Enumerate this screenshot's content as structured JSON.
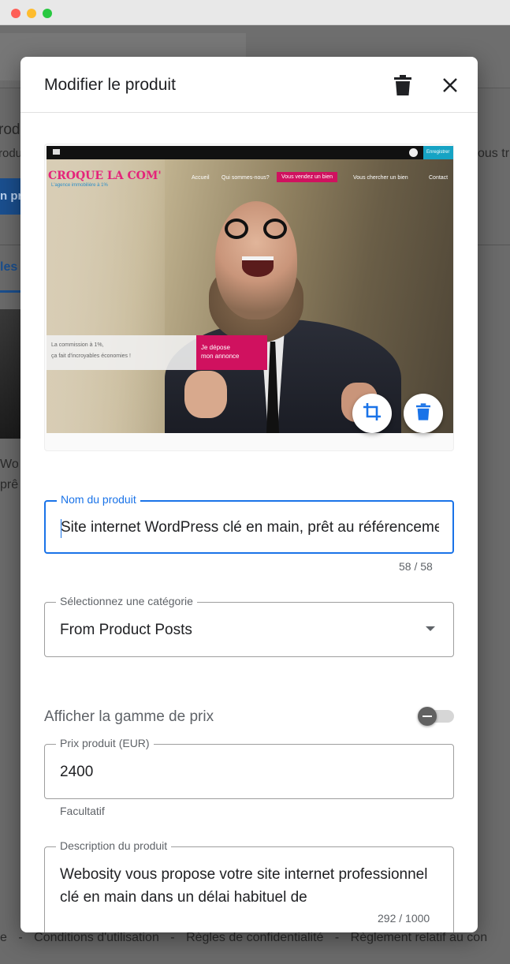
{
  "window": {
    "controls": [
      "close",
      "minimize",
      "maximize"
    ]
  },
  "background": {
    "heading_fragment": "rod",
    "subtext_fragment": "rodu",
    "right_text_fragment": "ous tr",
    "button_fragment": "n pr",
    "tab_fragment": "les",
    "card_title_fragment": "Wo",
    "card_sub_fragment": "prê",
    "footer": {
      "sep": "-",
      "items": [
        "e",
        "Conditions d'utilisation",
        "Règles de confidentialité",
        "Règlement relatif au con"
      ]
    }
  },
  "dialog": {
    "title": "Modifier le produit",
    "icons": {
      "delete": "trash-icon",
      "close": "close-icon"
    }
  },
  "preview": {
    "logo": "CROQUE LA COM'",
    "tagline": "L'agence immobilière à 1%",
    "cta_top": "Enregistrer",
    "nav": [
      "Accueil",
      "Qui sommes-nous?",
      "Vous vendez un bien",
      "Vous chercher un bien",
      "Contact"
    ],
    "promo_line1": "La commission à 1%,",
    "promo_line2": "ça fait d'incroyables économies !",
    "promo_cta_line1": "Je dépose",
    "promo_cta_line2": "mon annonce",
    "buttons": {
      "crop": "crop-icon",
      "delete": "trash-icon"
    }
  },
  "form": {
    "name": {
      "label": "Nom du produit",
      "value": "Site internet WordPress clé en main, prêt au référencement",
      "counter": "58 / 58"
    },
    "category": {
      "label": "Sélectionnez une catégorie",
      "value": "From Product Posts"
    },
    "price_range": {
      "label": "Afficher la gamme de prix",
      "enabled": false
    },
    "price": {
      "label": "Prix produit (EUR)",
      "value": "2400",
      "helper": "Facultatif"
    },
    "description": {
      "label": "Description du produit",
      "value": "Webosity vous propose votre site internet professionnel clé en main dans un délai habituel de",
      "counter": "292 / 1000"
    }
  },
  "colors": {
    "accent": "#1a73e8",
    "brand_pink": "#d0115f",
    "brand_cyan": "#16a3c4"
  }
}
